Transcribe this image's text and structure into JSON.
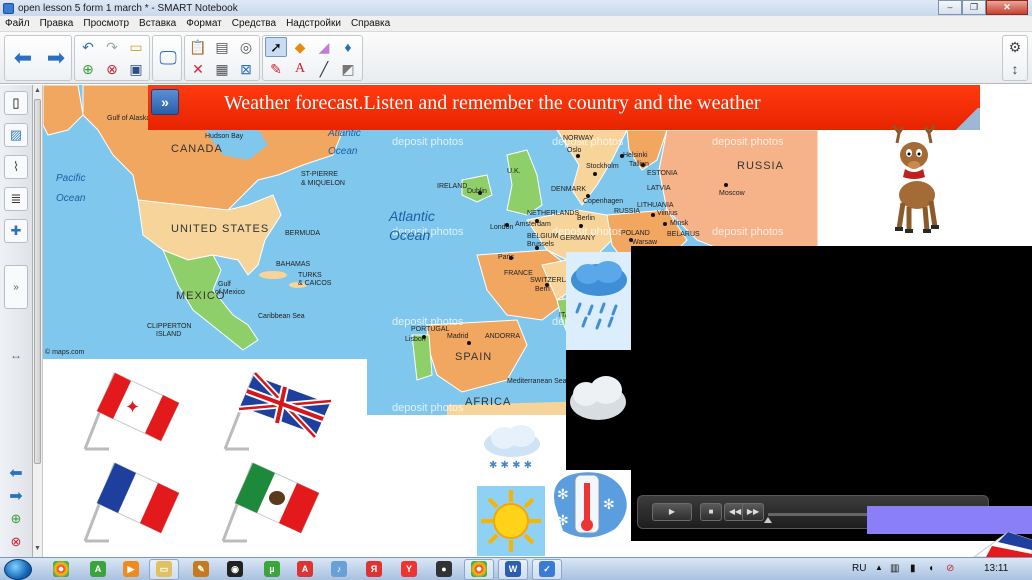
{
  "window": {
    "title": "open lesson 5 form 1 march * - SMART Notebook"
  },
  "menu": [
    "Файл",
    "Правка",
    "Просмотр",
    "Вставка",
    "Формат",
    "Средства",
    "Надстройки",
    "Справка"
  ],
  "slide": {
    "banner_title": "Weather forecast.Listen and remember the country and the weather",
    "map_na": {
      "labels": {
        "canada": "CANADA",
        "united_states": "UNITED STATES",
        "mexico": "MEXICO",
        "pacific1": "Pacific",
        "pacific2": "Ocean",
        "atlantic1": "Atlantic",
        "atlantic2": "Ocean",
        "gulf_alaska": "Gulf of Alaska",
        "hudson_bay": "Hudson Bay",
        "st_pierre": "ST-PIERRE",
        "miquelon": "& MIQUELON",
        "bermuda": "BERMUDA",
        "bahamas": "BAHAMAS",
        "turks": "TURKS",
        "caicos": "& CAICOS",
        "gulf_mexico1": "Gulf",
        "gulf_mexico2": "of Mexico",
        "caribbean": "Caribbean Sea",
        "clipperton1": "CLIPPERTON",
        "clipperton2": "ISLAND",
        "credit": "© maps.com"
      }
    },
    "map_eu": {
      "labels": {
        "russia": "RUSSIA",
        "atlantic1": "Atlantic",
        "atlantic2": "Ocean",
        "norway": "NORWAY",
        "oslo": "Oslo",
        "helsinki": "Helsinki",
        "stockholm": "Stockholm",
        "estonia": "ESTONIA",
        "tallinn": "Tallinn",
        "latvia": "LATVIA",
        "moscow": "Moscow",
        "ireland": "IRELAND",
        "dublin": "Dublin",
        "uk": "U.K.",
        "denmark": "DENMARK",
        "copenhagen": "Copenhagen",
        "russia_small": "RUSSIA",
        "lithuania": "LITHUANIA",
        "vilnius": "Vilnius",
        "minsk": "Minsk",
        "netherlands": "NETHERLANDS",
        "amsterdam": "Amsterdam",
        "berlin": "Berlin",
        "london": "London",
        "belarus": "BELARUS",
        "poland": "POLAND",
        "warsaw": "Warsaw",
        "belgium": "BELGIUM",
        "brussels": "Brussels",
        "germany": "GERMANY",
        "paris": "Paris",
        "france": "FRANCE",
        "switzerland": "SWITZERLAND",
        "bern": "Bern",
        "portugal": "PORTUGAL",
        "lisbon": "Lisbon",
        "madrid": "Madrid",
        "andorra": "ANDORRA",
        "spain": "SPAIN",
        "ita": "ITA",
        "med_sea": "Mediterranean Sea",
        "africa": "AFRICA"
      },
      "watermark": "deposit photos"
    }
  },
  "taskbar": {
    "lang": "RU",
    "time": "13:11"
  },
  "colors": {
    "banner": "#e82400",
    "ocean": "#7fc7ec",
    "video_bg": "#000000",
    "lilac": "#8b7ff7"
  }
}
